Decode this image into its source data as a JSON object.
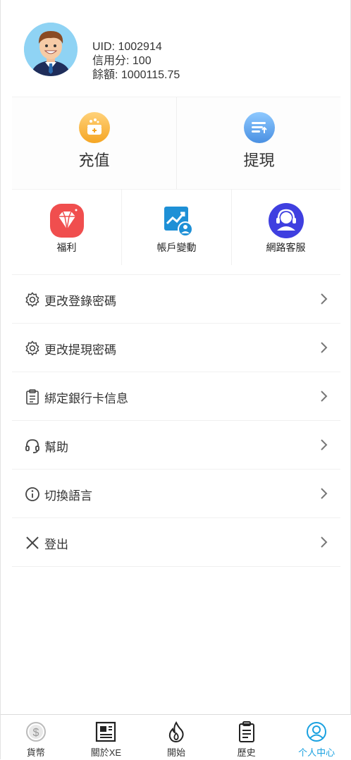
{
  "profile": {
    "uid": "UID: 1002914",
    "credit": "信用分: 100",
    "balance": "餘額: 1000115.75"
  },
  "actions": [
    {
      "label": "充值",
      "icon": "deposit-icon"
    },
    {
      "label": "提現",
      "icon": "withdraw-icon"
    }
  ],
  "quick": [
    {
      "label": "福利",
      "icon": "diamond-icon"
    },
    {
      "label": "帳戶變動",
      "icon": "account-chart-icon"
    },
    {
      "label": "網路客服",
      "icon": "customer-service-icon"
    }
  ],
  "menu": [
    {
      "label": "更改登錄密碼",
      "icon": "gear-icon"
    },
    {
      "label": "更改提現密碼",
      "icon": "gear-icon"
    },
    {
      "label": "綁定銀行卡信息",
      "icon": "clipboard-icon"
    },
    {
      "label": "幫助",
      "icon": "headset-icon"
    },
    {
      "label": "切換語言",
      "icon": "info-icon"
    },
    {
      "label": "登出",
      "icon": "close-icon"
    }
  ],
  "tabs": [
    {
      "label": "貨幣",
      "icon": "dollar-icon",
      "active": false
    },
    {
      "label": "關於XE",
      "icon": "news-icon",
      "active": false
    },
    {
      "label": "開始",
      "icon": "flame-icon",
      "active": false
    },
    {
      "label": "歷史",
      "icon": "clipboard-icon",
      "active": false
    },
    {
      "label": "个人中心",
      "icon": "user-icon",
      "active": true
    }
  ],
  "colors": {
    "accent": "#1aa1e0",
    "deposit": "#f7b23b",
    "withdraw": "#4a90e2",
    "diamond": "#f04e4e",
    "account": "#1e90d6",
    "service": "#3f3fe0"
  }
}
